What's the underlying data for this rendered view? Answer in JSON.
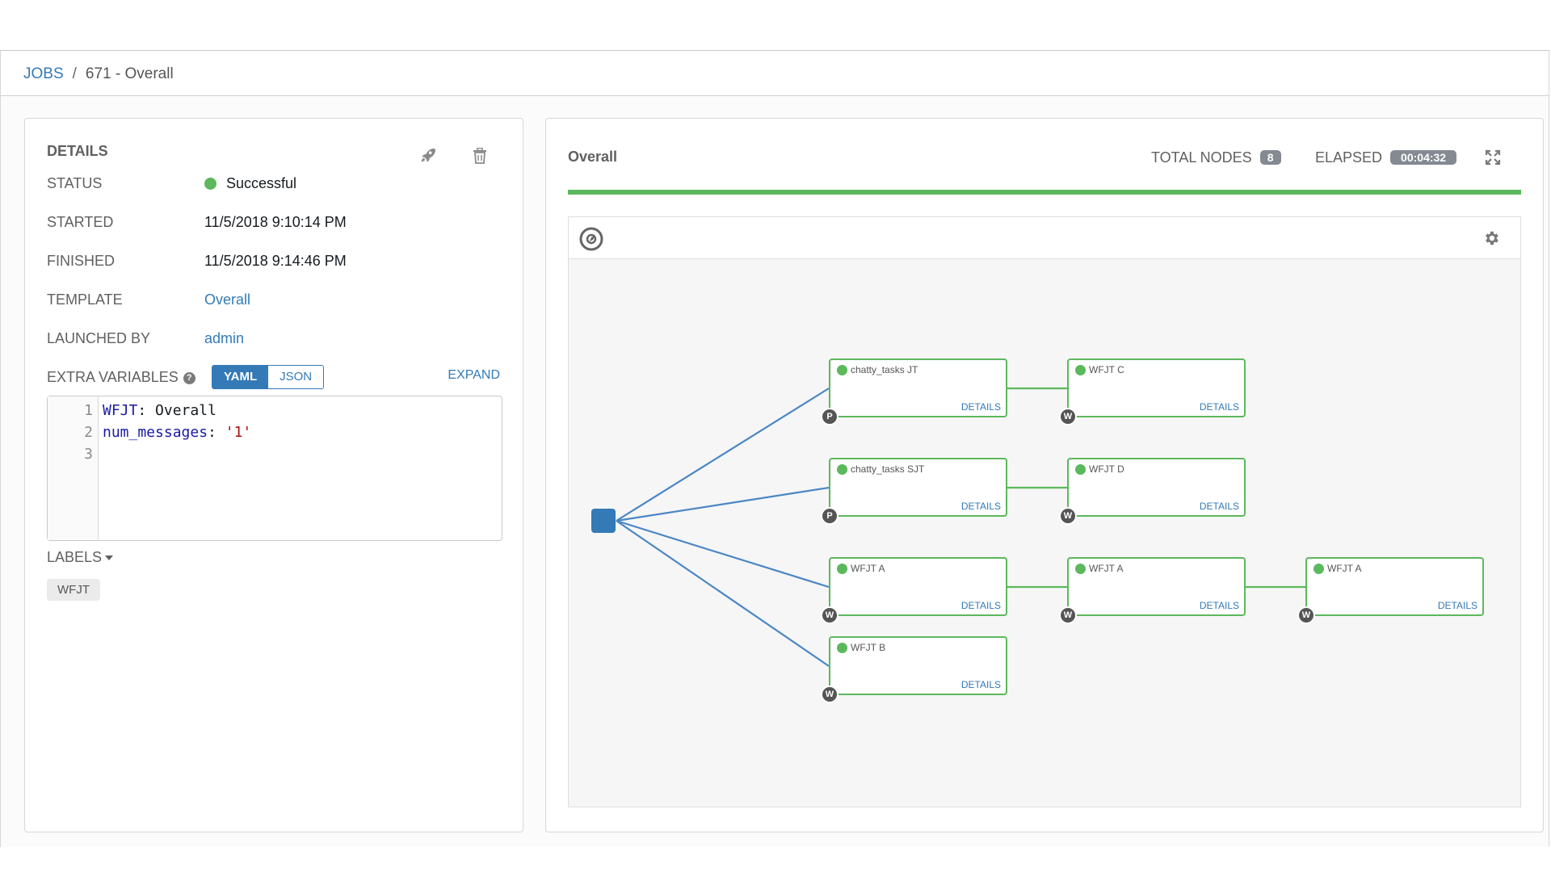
{
  "breadcrumb": {
    "jobs": "JOBS",
    "separator": "/",
    "current": "671 - Overall"
  },
  "details": {
    "title": "DETAILS",
    "status_label": "STATUS",
    "status_value": "Successful",
    "started_label": "STARTED",
    "started_value": "11/5/2018 9:10:14 PM",
    "finished_label": "FINISHED",
    "finished_value": "11/5/2018 9:14:46 PM",
    "template_label": "TEMPLATE",
    "template_value": "Overall",
    "launched_by_label": "LAUNCHED BY",
    "launched_by_value": "admin",
    "extra_vars_label": "EXTRA VARIABLES",
    "help_glyph": "?",
    "yaml_label": "YAML",
    "json_label": "JSON",
    "expand_label": "EXPAND",
    "code": {
      "line_numbers": [
        "1",
        "2",
        "3"
      ],
      "line1_key": "WFJT",
      "line1_sep": ": ",
      "line1_value": "Overall",
      "line2_key": "num_messages",
      "line2_sep": ": ",
      "line2_value": "'1'"
    },
    "labels_title": "LABELS",
    "label_chip": "WFJT",
    "icons": {
      "relaunch": "rocket-icon",
      "delete": "trash-icon"
    }
  },
  "graph": {
    "title": "Overall",
    "total_nodes_label": "TOTAL NODES",
    "total_nodes_value": "8",
    "elapsed_label": "ELAPSED",
    "elapsed_value": "00:04:32",
    "progress": 1.0,
    "icons": {
      "fullscreen": "fullscreen-icon",
      "compass": "compass-icon",
      "settings": "gear-icon"
    },
    "nodes": [
      {
        "name": "chatty_tasks JT",
        "type": "P",
        "details": "DETAILS"
      },
      {
        "name": "WFJT C",
        "type": "W",
        "details": "DETAILS"
      },
      {
        "name": "chatty_tasks SJT",
        "type": "P",
        "details": "DETAILS"
      },
      {
        "name": "WFJT D",
        "type": "W",
        "details": "DETAILS"
      },
      {
        "name": "WFJT A",
        "type": "W",
        "details": "DETAILS"
      },
      {
        "name": "WFJT A",
        "type": "W",
        "details": "DETAILS"
      },
      {
        "name": "WFJT A",
        "type": "W",
        "details": "DETAILS"
      },
      {
        "name": "WFJT B",
        "type": "W",
        "details": "DETAILS"
      }
    ]
  },
  "colors": {
    "accent": "#337ab7",
    "success": "#5cb85c"
  }
}
